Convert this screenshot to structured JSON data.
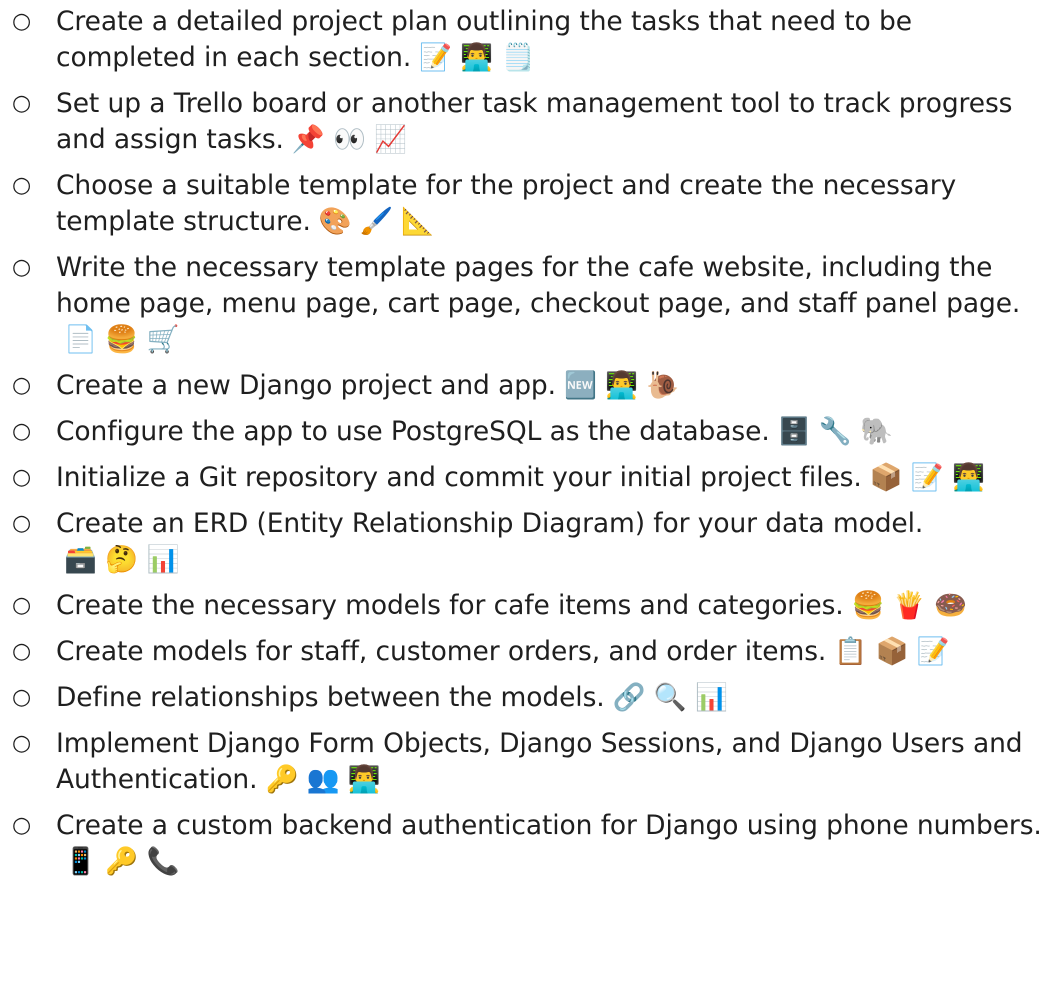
{
  "bullet_glyph": "○",
  "items": [
    {
      "text": "Create a detailed project plan outlining the tasks that need to be completed in each section.",
      "emojis": "📝 👨‍💻 🗒️"
    },
    {
      "text": "Set up a Trello board or another task management tool to track progress and assign tasks.",
      "emojis": "📌 👀 📈"
    },
    {
      "text": "Choose a suitable template for the project and create the necessary template structure.",
      "emojis": "🎨 🖌️ 📐"
    },
    {
      "text": "Write the necessary template pages for the cafe website, including the home page, menu page, cart page, checkout page, and staff panel page.",
      "emojis": "📄 🍔 🛒"
    },
    {
      "text": "Create a new Django project and app.",
      "emojis": "🆕 👨‍💻 🐌"
    },
    {
      "text": "Configure the app to use PostgreSQL as the database.",
      "emojis": "🗄️ 🔧 🐘"
    },
    {
      "text": "Initialize a Git repository and commit your initial project files.",
      "emojis": "📦 📝 👨‍💻"
    },
    {
      "text": "Create an ERD (Entity Relationship Diagram) for your data model.",
      "emojis": "🗃️ 🤔 📊"
    },
    {
      "text": "Create the necessary models for cafe items and categories.",
      "emojis": "🍔 🍟 🍩"
    },
    {
      "text": "Create models for staff, customer orders, and order items.",
      "emojis": "📋 📦 📝"
    },
    {
      "text": "Define relationships between the models.",
      "emojis": "🔗 🔍 📊"
    },
    {
      "text": "Implement Django Form Objects, Django Sessions, and Django Users and Authentication.",
      "emojis": "🔑 👥 👨‍💻"
    },
    {
      "text": "Create a custom backend authentication for Django using phone numbers.",
      "emojis": "📱 🔑 📞"
    }
  ]
}
